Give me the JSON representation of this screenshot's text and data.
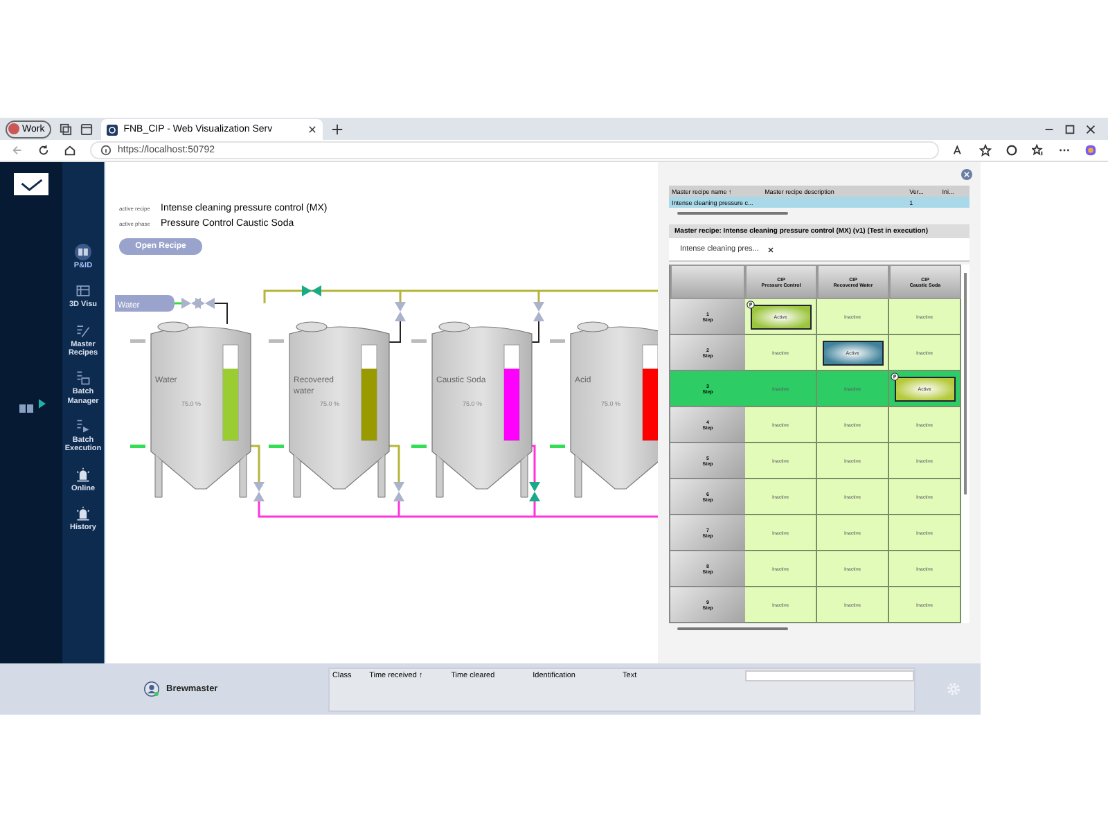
{
  "browser": {
    "profile": "Work",
    "tab_title": "FNB_CIP - Web Visualization Serv",
    "url": "https://localhost:50792"
  },
  "sidebar": {
    "items": [
      {
        "label": "P&ID",
        "kind": "book",
        "selected": true
      },
      {
        "label": "3D Visu",
        "kind": "cube",
        "selected": false
      },
      {
        "label": "Master Recipes",
        "kind": "edit",
        "selected": false
      },
      {
        "label": "Batch Manager",
        "kind": "list",
        "selected": false
      },
      {
        "label": "Batch Execution",
        "kind": "play",
        "selected": false
      },
      {
        "label": "Online",
        "kind": "alarm",
        "selected": false
      },
      {
        "label": "History",
        "kind": "alarm",
        "selected": false
      }
    ]
  },
  "recipe_info": [
    {
      "label": "active recipe",
      "value": "Intense cleaning pressure control (MX)"
    },
    {
      "label": "active phase",
      "value": "Pressure Control Caustic Soda"
    }
  ],
  "open_recipe_button": "Open Recipe",
  "pid": {
    "source": "Water",
    "tanks": [
      {
        "name": "Water",
        "reading": "75.0 %",
        "level": 0.75,
        "color": "#9acd32"
      },
      {
        "name": "Recovered water",
        "reading": "75.0 %",
        "level": 0.75,
        "color": "#999900"
      },
      {
        "name": "Caustic Soda",
        "reading": "75.0 %",
        "level": 0.75,
        "color": "#ff00ff"
      },
      {
        "name": "Acid",
        "reading": "75.0 %",
        "level": 0.75,
        "color": "#ff0000"
      }
    ]
  },
  "recipe_panel": {
    "table": {
      "columns": [
        "Master recipe name ↑",
        "Master recipe description",
        "Ver...",
        "Ini..."
      ],
      "rows": [
        {
          "cells": [
            "Intense cleaning pressure c...",
            "",
            "1",
            ""
          ],
          "selected": true
        }
      ]
    },
    "header": "Master recipe: Intense cleaning pressure control (MX) (v1) (Test in execution)",
    "tab": "Intense cleaning pres...",
    "grid": {
      "columns": [
        {
          "group": "CIP",
          "name": "Pressure Control"
        },
        {
          "group": "CIP",
          "name": "Recovered Water"
        },
        {
          "group": "CIP",
          "name": "Caustic Soda"
        }
      ],
      "rows": [
        {
          "number": "1",
          "unit": "Step",
          "selected": false,
          "cells": [
            {
              "text": "Active",
              "color": "#9bc53d",
              "flag": true
            },
            {
              "text": "Inactive",
              "flag": false
            },
            {
              "text": "Inactive",
              "flag": false
            }
          ]
        },
        {
          "number": "2",
          "unit": "Step",
          "selected": false,
          "cells": [
            {
              "text": "Inactive",
              "flag": false
            },
            {
              "text": "Active",
              "color": "#3f8299",
              "flag": false
            },
            {
              "text": "Inactive",
              "flag": false
            }
          ]
        },
        {
          "number": "3",
          "unit": "Step",
          "selected": true,
          "cells": [
            {
              "text": "Inactive",
              "flag": false
            },
            {
              "text": "Inactive",
              "flag": false
            },
            {
              "text": "Active",
              "color": "#b5c93a",
              "flag": true
            }
          ]
        },
        {
          "number": "4",
          "unit": "Step",
          "selected": false,
          "cells": [
            {
              "text": "Inactive",
              "flag": false
            },
            {
              "text": "Inactive",
              "flag": false
            },
            {
              "text": "Inactive",
              "flag": false
            }
          ]
        },
        {
          "number": "5",
          "unit": "Step",
          "selected": false,
          "cells": [
            {
              "text": "Inactive",
              "flag": false
            },
            {
              "text": "Inactive",
              "flag": false
            },
            {
              "text": "Inactive",
              "flag": false
            }
          ]
        },
        {
          "number": "6",
          "unit": "Step",
          "selected": false,
          "cells": [
            {
              "text": "Inactive",
              "flag": false
            },
            {
              "text": "Inactive",
              "flag": false
            },
            {
              "text": "Inactive",
              "flag": false
            }
          ]
        },
        {
          "number": "7",
          "unit": "Step",
          "selected": false,
          "cells": [
            {
              "text": "Inactive",
              "flag": false
            },
            {
              "text": "Inactive",
              "flag": false
            },
            {
              "text": "Inactive",
              "flag": false
            }
          ]
        },
        {
          "number": "8",
          "unit": "Step",
          "selected": false,
          "cells": [
            {
              "text": "Inactive",
              "flag": false
            },
            {
              "text": "Inactive",
              "flag": false
            },
            {
              "text": "Inactive",
              "flag": false
            }
          ]
        },
        {
          "number": "9",
          "unit": "Step",
          "selected": false,
          "cells": [
            {
              "text": "Inactive",
              "flag": false
            },
            {
              "text": "Inactive",
              "flag": false
            },
            {
              "text": "Inactive",
              "flag": false
            }
          ]
        }
      ]
    }
  },
  "alarm_bar": {
    "user": "Brewmaster",
    "columns": [
      "Class",
      "Time received ↑",
      "Time cleared",
      "Identification",
      "Text"
    ]
  }
}
